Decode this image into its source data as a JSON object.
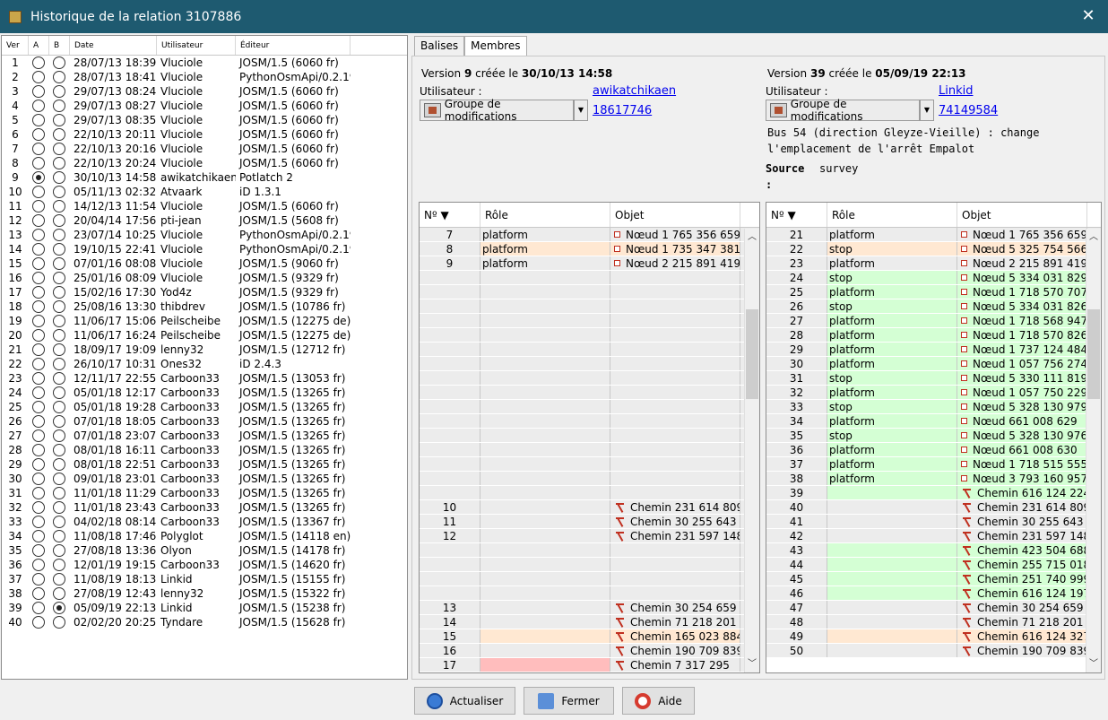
{
  "window": {
    "title": "Historique de la relation 3107886"
  },
  "history": {
    "headers": {
      "ver": "Ver",
      "a": "A",
      "b": "B",
      "date": "Date",
      "user": "Utilisateur",
      "editor": "Éditeur"
    },
    "rows": [
      {
        "ver": "1",
        "date": "28/07/13 18:39",
        "user": "Vluciole",
        "editor": "JOSM/1.5 (6060 fr)",
        "a": false,
        "b": false
      },
      {
        "ver": "2",
        "date": "28/07/13 18:41",
        "user": "Vluciole",
        "editor": "PythonOsmApi/0.2.19",
        "a": false,
        "b": false
      },
      {
        "ver": "3",
        "date": "29/07/13 08:24",
        "user": "Vluciole",
        "editor": "JOSM/1.5 (6060 fr)",
        "a": false,
        "b": false
      },
      {
        "ver": "4",
        "date": "29/07/13 08:27",
        "user": "Vluciole",
        "editor": "JOSM/1.5 (6060 fr)",
        "a": false,
        "b": false
      },
      {
        "ver": "5",
        "date": "29/07/13 08:35",
        "user": "Vluciole",
        "editor": "JOSM/1.5 (6060 fr)",
        "a": false,
        "b": false
      },
      {
        "ver": "6",
        "date": "22/10/13 20:11",
        "user": "Vluciole",
        "editor": "JOSM/1.5 (6060 fr)",
        "a": false,
        "b": false
      },
      {
        "ver": "7",
        "date": "22/10/13 20:16",
        "user": "Vluciole",
        "editor": "JOSM/1.5 (6060 fr)",
        "a": false,
        "b": false
      },
      {
        "ver": "8",
        "date": "22/10/13 20:24",
        "user": "Vluciole",
        "editor": "JOSM/1.5 (6060 fr)",
        "a": false,
        "b": false
      },
      {
        "ver": "9",
        "date": "30/10/13 14:58",
        "user": "awikatchikaen",
        "editor": "Potlatch 2",
        "a": true,
        "b": false
      },
      {
        "ver": "10",
        "date": "05/11/13 02:32",
        "user": "Atvaark",
        "editor": "iD 1.3.1",
        "a": false,
        "b": false
      },
      {
        "ver": "11",
        "date": "14/12/13 11:54",
        "user": "Vluciole",
        "editor": "JOSM/1.5 (6060 fr)",
        "a": false,
        "b": false
      },
      {
        "ver": "12",
        "date": "20/04/14 17:56",
        "user": "pti-jean",
        "editor": "JOSM/1.5 (5608 fr)",
        "a": false,
        "b": false
      },
      {
        "ver": "13",
        "date": "23/07/14 10:25",
        "user": "Vluciole",
        "editor": "PythonOsmApi/0.2.19",
        "a": false,
        "b": false
      },
      {
        "ver": "14",
        "date": "19/10/15 22:41",
        "user": "Vluciole",
        "editor": "PythonOsmApi/0.2.19",
        "a": false,
        "b": false
      },
      {
        "ver": "15",
        "date": "07/01/16 08:08",
        "user": "Vluciole",
        "editor": "JOSM/1.5 (9060 fr)",
        "a": false,
        "b": false
      },
      {
        "ver": "16",
        "date": "25/01/16 08:09",
        "user": "Vluciole",
        "editor": "JOSM/1.5 (9329 fr)",
        "a": false,
        "b": false
      },
      {
        "ver": "17",
        "date": "15/02/16 17:30",
        "user": "Yod4z",
        "editor": "JOSM/1.5 (9329 fr)",
        "a": false,
        "b": false
      },
      {
        "ver": "18",
        "date": "25/08/16 13:30",
        "user": "thibdrev",
        "editor": "JOSM/1.5 (10786 fr)",
        "a": false,
        "b": false
      },
      {
        "ver": "19",
        "date": "11/06/17 15:06",
        "user": "Peilscheibe",
        "editor": "JOSM/1.5 (12275 de)",
        "a": false,
        "b": false
      },
      {
        "ver": "20",
        "date": "11/06/17 16:24",
        "user": "Peilscheibe",
        "editor": "JOSM/1.5 (12275 de)",
        "a": false,
        "b": false
      },
      {
        "ver": "21",
        "date": "18/09/17 19:09",
        "user": "lenny32",
        "editor": "JOSM/1.5 (12712 fr)",
        "a": false,
        "b": false
      },
      {
        "ver": "22",
        "date": "26/10/17 10:31",
        "user": "Ones32",
        "editor": "iD 2.4.3",
        "a": false,
        "b": false
      },
      {
        "ver": "23",
        "date": "12/11/17 22:55",
        "user": "Carboon33",
        "editor": "JOSM/1.5 (13053 fr)",
        "a": false,
        "b": false
      },
      {
        "ver": "24",
        "date": "05/01/18 12:17",
        "user": "Carboon33",
        "editor": "JOSM/1.5 (13265 fr)",
        "a": false,
        "b": false
      },
      {
        "ver": "25",
        "date": "05/01/18 19:28",
        "user": "Carboon33",
        "editor": "JOSM/1.5 (13265 fr)",
        "a": false,
        "b": false
      },
      {
        "ver": "26",
        "date": "07/01/18 18:05",
        "user": "Carboon33",
        "editor": "JOSM/1.5 (13265 fr)",
        "a": false,
        "b": false
      },
      {
        "ver": "27",
        "date": "07/01/18 23:07",
        "user": "Carboon33",
        "editor": "JOSM/1.5 (13265 fr)",
        "a": false,
        "b": false
      },
      {
        "ver": "28",
        "date": "08/01/18 16:11",
        "user": "Carboon33",
        "editor": "JOSM/1.5 (13265 fr)",
        "a": false,
        "b": false
      },
      {
        "ver": "29",
        "date": "08/01/18 22:51",
        "user": "Carboon33",
        "editor": "JOSM/1.5 (13265 fr)",
        "a": false,
        "b": false
      },
      {
        "ver": "30",
        "date": "09/01/18 23:01",
        "user": "Carboon33",
        "editor": "JOSM/1.5 (13265 fr)",
        "a": false,
        "b": false
      },
      {
        "ver": "31",
        "date": "11/01/18 11:29",
        "user": "Carboon33",
        "editor": "JOSM/1.5 (13265 fr)",
        "a": false,
        "b": false
      },
      {
        "ver": "32",
        "date": "11/01/18 23:43",
        "user": "Carboon33",
        "editor": "JOSM/1.5 (13265 fr)",
        "a": false,
        "b": false
      },
      {
        "ver": "33",
        "date": "04/02/18 08:14",
        "user": "Carboon33",
        "editor": "JOSM/1.5 (13367 fr)",
        "a": false,
        "b": false
      },
      {
        "ver": "34",
        "date": "11/08/18 17:46",
        "user": "Polyglot",
        "editor": "JOSM/1.5 (14118 en)",
        "a": false,
        "b": false
      },
      {
        "ver": "35",
        "date": "27/08/18 13:36",
        "user": "Olyon",
        "editor": "JOSM/1.5 (14178 fr)",
        "a": false,
        "b": false
      },
      {
        "ver": "36",
        "date": "12/01/19 19:15",
        "user": "Carboon33",
        "editor": "JOSM/1.5 (14620 fr)",
        "a": false,
        "b": false
      },
      {
        "ver": "37",
        "date": "11/08/19 18:13",
        "user": "Linkid",
        "editor": "JOSM/1.5 (15155 fr)",
        "a": false,
        "b": false
      },
      {
        "ver": "38",
        "date": "27/08/19 12:43",
        "user": "lenny32",
        "editor": "JOSM/1.5 (15322 fr)",
        "a": false,
        "b": false
      },
      {
        "ver": "39",
        "date": "05/09/19 22:13",
        "user": "Linkid",
        "editor": "JOSM/1.5 (15238 fr)",
        "a": false,
        "b": true
      },
      {
        "ver": "40",
        "date": "02/02/20 20:25",
        "user": "Tyndare",
        "editor": "JOSM/1.5 (15628 fr)",
        "a": false,
        "b": false
      }
    ]
  },
  "tabs": [
    {
      "label": "Balises",
      "active": false
    },
    {
      "label": "Membres",
      "active": true
    }
  ],
  "left_version": {
    "prefix": "Version",
    "number": "9",
    "created": "créée le",
    "datetime": "30/10/13 14:58",
    "user_label": "Utilisateur :",
    "user": "awikatchikaen",
    "changeset_label": "Groupe de modifications",
    "changeset": "18617746"
  },
  "right_version": {
    "prefix": "Version",
    "number": "39",
    "created": "créée le",
    "datetime": "05/09/19 22:13",
    "user_label": "Utilisateur :",
    "user": "Linkid",
    "changeset_label": "Groupe de modifications",
    "changeset": "74149584",
    "comment_line1": "Bus 54 (direction Gleyze-Vieille) : change",
    "comment_line2": "l'emplacement de l'arrêt Empalot",
    "source_label": "Source",
    "source_colon": ":",
    "source_value": "survey"
  },
  "members_headers": {
    "num": "Nº ▼",
    "role": "Rôle",
    "object": "Objet"
  },
  "members_left": [
    {
      "num": "7",
      "role": "platform",
      "type": "node",
      "object": "Nœud 1 765 356 659",
      "bg": "gray"
    },
    {
      "num": "8",
      "role": "platform",
      "type": "node",
      "object": "Nœud 1 735 347 381",
      "bg": "peach"
    },
    {
      "num": "9",
      "role": "platform",
      "type": "node",
      "object": "Nœud 2 215 891 419",
      "bg": "gray"
    },
    {
      "num": "",
      "role": "",
      "type": "",
      "object": "",
      "bg": "gray"
    },
    {
      "num": "",
      "role": "",
      "type": "",
      "object": "",
      "bg": "gray"
    },
    {
      "num": "",
      "role": "",
      "type": "",
      "object": "",
      "bg": "gray"
    },
    {
      "num": "",
      "role": "",
      "type": "",
      "object": "",
      "bg": "gray"
    },
    {
      "num": "",
      "role": "",
      "type": "",
      "object": "",
      "bg": "gray"
    },
    {
      "num": "",
      "role": "",
      "type": "",
      "object": "",
      "bg": "gray"
    },
    {
      "num": "",
      "role": "",
      "type": "",
      "object": "",
      "bg": "gray"
    },
    {
      "num": "",
      "role": "",
      "type": "",
      "object": "",
      "bg": "gray"
    },
    {
      "num": "",
      "role": "",
      "type": "",
      "object": "",
      "bg": "gray"
    },
    {
      "num": "",
      "role": "",
      "type": "",
      "object": "",
      "bg": "gray"
    },
    {
      "num": "",
      "role": "",
      "type": "",
      "object": "",
      "bg": "gray"
    },
    {
      "num": "",
      "role": "",
      "type": "",
      "object": "",
      "bg": "gray"
    },
    {
      "num": "",
      "role": "",
      "type": "",
      "object": "",
      "bg": "gray"
    },
    {
      "num": "",
      "role": "",
      "type": "",
      "object": "",
      "bg": "gray"
    },
    {
      "num": "",
      "role": "",
      "type": "",
      "object": "",
      "bg": "gray"
    },
    {
      "num": "",
      "role": "",
      "type": "",
      "object": "",
      "bg": "gray"
    },
    {
      "num": "10",
      "role": "",
      "type": "way",
      "object": "Chemin 231 614 809",
      "bg": "gray"
    },
    {
      "num": "11",
      "role": "",
      "type": "way",
      "object": "Chemin 30 255 643",
      "bg": "gray"
    },
    {
      "num": "12",
      "role": "",
      "type": "way",
      "object": "Chemin 231 597 148",
      "bg": "gray"
    },
    {
      "num": "",
      "role": "",
      "type": "",
      "object": "",
      "bg": "gray"
    },
    {
      "num": "",
      "role": "",
      "type": "",
      "object": "",
      "bg": "gray"
    },
    {
      "num": "",
      "role": "",
      "type": "",
      "object": "",
      "bg": "gray"
    },
    {
      "num": "",
      "role": "",
      "type": "",
      "object": "",
      "bg": "gray"
    },
    {
      "num": "13",
      "role": "",
      "type": "way",
      "object": "Chemin 30 254 659",
      "bg": "gray"
    },
    {
      "num": "14",
      "role": "",
      "type": "way",
      "object": "Chemin 71 218 201",
      "bg": "gray"
    },
    {
      "num": "15",
      "role": "",
      "type": "way",
      "object": "Chemin 165 023 884",
      "bg": "peach"
    },
    {
      "num": "16",
      "role": "",
      "type": "way",
      "object": "Chemin 190 709 839",
      "bg": "gray"
    },
    {
      "num": "17",
      "role": "",
      "type": "way",
      "object": "Chemin 7 317 295",
      "bg": "pink"
    }
  ],
  "members_right": [
    {
      "num": "21",
      "role": "platform",
      "type": "node",
      "object": "Nœud 1 765 356 659",
      "bg": "gray"
    },
    {
      "num": "22",
      "role": "stop",
      "type": "node",
      "object": "Nœud 5 325 754 566",
      "bg": "peach"
    },
    {
      "num": "23",
      "role": "platform",
      "type": "node",
      "object": "Nœud 2 215 891 419",
      "bg": "gray"
    },
    {
      "num": "24",
      "role": "stop",
      "type": "node",
      "object": "Nœud 5 334 031 829",
      "bg": "green"
    },
    {
      "num": "25",
      "role": "platform",
      "type": "node",
      "object": "Nœud 1 718 570 707",
      "bg": "green"
    },
    {
      "num": "26",
      "role": "stop",
      "type": "node",
      "object": "Nœud 5 334 031 826",
      "bg": "green"
    },
    {
      "num": "27",
      "role": "platform",
      "type": "node",
      "object": "Nœud 1 718 568 947",
      "bg": "green"
    },
    {
      "num": "28",
      "role": "platform",
      "type": "node",
      "object": "Nœud 1 718 570 826",
      "bg": "green"
    },
    {
      "num": "29",
      "role": "platform",
      "type": "node",
      "object": "Nœud 1 737 124 484",
      "bg": "green"
    },
    {
      "num": "30",
      "role": "platform",
      "type": "node",
      "object": "Nœud 1 057 756 274",
      "bg": "green"
    },
    {
      "num": "31",
      "role": "stop",
      "type": "node",
      "object": "Nœud 5 330 111 819",
      "bg": "green"
    },
    {
      "num": "32",
      "role": "platform",
      "type": "node",
      "object": "Nœud 1 057 750 229",
      "bg": "green"
    },
    {
      "num": "33",
      "role": "stop",
      "type": "node",
      "object": "Nœud 5 328 130 979",
      "bg": "green"
    },
    {
      "num": "34",
      "role": "platform",
      "type": "node",
      "object": "Nœud 661 008 629",
      "bg": "green"
    },
    {
      "num": "35",
      "role": "stop",
      "type": "node",
      "object": "Nœud 5 328 130 976",
      "bg": "green"
    },
    {
      "num": "36",
      "role": "platform",
      "type": "node",
      "object": "Nœud 661 008 630",
      "bg": "green"
    },
    {
      "num": "37",
      "role": "platform",
      "type": "node",
      "object": "Nœud 1 718 515 555",
      "bg": "green"
    },
    {
      "num": "38",
      "role": "platform",
      "type": "node",
      "object": "Nœud 3 793 160 957",
      "bg": "green"
    },
    {
      "num": "39",
      "role": "",
      "type": "way",
      "object": "Chemin 616 124 224",
      "bg": "green"
    },
    {
      "num": "40",
      "role": "",
      "type": "way",
      "object": "Chemin 231 614 809",
      "bg": "gray"
    },
    {
      "num": "41",
      "role": "",
      "type": "way",
      "object": "Chemin 30 255 643",
      "bg": "gray"
    },
    {
      "num": "42",
      "role": "",
      "type": "way",
      "object": "Chemin 231 597 148",
      "bg": "gray"
    },
    {
      "num": "43",
      "role": "",
      "type": "way",
      "object": "Chemin 423 504 688",
      "bg": "green"
    },
    {
      "num": "44",
      "role": "",
      "type": "way",
      "object": "Chemin 255 715 018",
      "bg": "green"
    },
    {
      "num": "45",
      "role": "",
      "type": "way",
      "object": "Chemin 251 740 999",
      "bg": "green"
    },
    {
      "num": "46",
      "role": "",
      "type": "way",
      "object": "Chemin 616 124 197",
      "bg": "green"
    },
    {
      "num": "47",
      "role": "",
      "type": "way",
      "object": "Chemin 30 254 659",
      "bg": "gray"
    },
    {
      "num": "48",
      "role": "",
      "type": "way",
      "object": "Chemin 71 218 201",
      "bg": "gray"
    },
    {
      "num": "49",
      "role": "",
      "type": "way",
      "object": "Chemin 616 124 327",
      "bg": "peach"
    },
    {
      "num": "50",
      "role": "",
      "type": "way",
      "object": "Chemin 190 709 839",
      "bg": "gray"
    }
  ],
  "buttons": {
    "refresh": "Actualiser",
    "close": "Fermer",
    "help": "Aide"
  },
  "colors": {
    "titlebar": "#1e5a70",
    "changed": "#ffe8d2",
    "added": "#d4ffd4",
    "removed": "#ffbdbd"
  }
}
